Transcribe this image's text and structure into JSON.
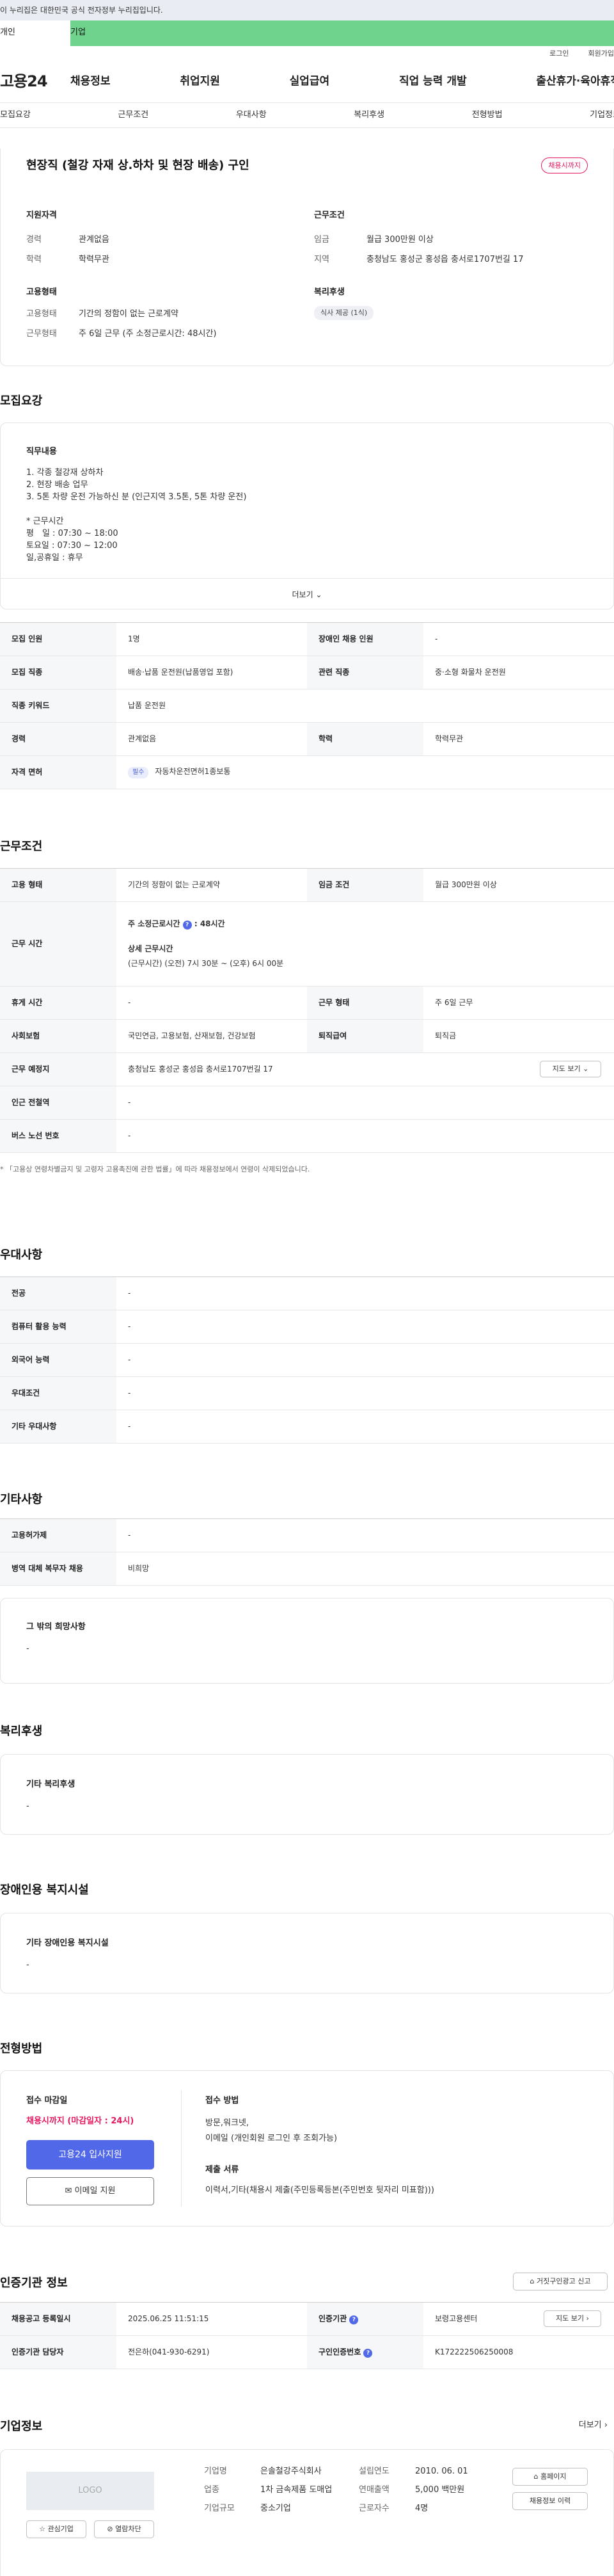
{
  "notice": "이 누리집은 대한민국 공식 전자정부 누리집입니다.",
  "tabs": [
    "개인",
    "기업"
  ],
  "util": [
    "로그인",
    "회원가입"
  ],
  "logo": "고용24",
  "gnb": [
    "채용정보",
    "취업지원",
    "실업급여",
    "직업 능력 개발",
    "출산휴가·육아휴직"
  ],
  "subnav": [
    "모집요강",
    "근무조건",
    "우대사항",
    "복리후생",
    "전형방법",
    "기업정보"
  ],
  "job": {
    "title": "현장직 (철강 자재 상.하차 및 현장 배송) 구인",
    "badge": "채용시까지",
    "req_title": "지원자격",
    "req": [
      {
        "k": "경력",
        "v": "관계없음"
      },
      {
        "k": "학력",
        "v": "학력무관"
      }
    ],
    "cond_title": "근무조건",
    "cond": [
      {
        "k": "임금",
        "v": "월급 300만원 이상"
      },
      {
        "k": "지역",
        "v": "충청남도 홍성군 홍성읍 충서로1707번길 17"
      }
    ],
    "emp_title": "고용형태",
    "emp": [
      {
        "k": "고용형태",
        "v": "기간의 정함이 없는 근로계약"
      },
      {
        "k": "근무형태",
        "v": "주 6일 근무 (주 소정근로시간: 48시간)"
      }
    ],
    "welfare_title": "복리후생",
    "welfare_pill": "식사 제공 (1식)"
  },
  "recruit": {
    "title": "모집요강",
    "duty_title": "직무내용",
    "duty": [
      "1. 각종 철강재 상하차",
      "2. 현장 배송 업무",
      "3. 5톤 차량 운전 가능하신 분 (인근지역 3.5톤, 5톤 차량 운전)",
      "",
      "* 근무시간",
      "평　일 : 07:30 ~ 18:00",
      "토요일 : 07:30 ~ 12:00",
      "일,공휴일 : 휴무"
    ],
    "more": "더보기",
    "table": [
      {
        "k1": "모집 인원",
        "v1": "1명",
        "k2": "장애인 채용 인원",
        "v2": "-"
      },
      {
        "k1": "모집 직종",
        "v1": "배송·납품 운전원(납품영업 포함)",
        "k2": "관련 직종",
        "v2": "중·소형 화물차 운전원"
      },
      {
        "k1": "직종 키워드",
        "v1": "납품 운전원"
      },
      {
        "k1": "경력",
        "v1": "관계없음",
        "k2": "학력",
        "v2": "학력무관"
      },
      {
        "k1": "자격 면허",
        "pill": "필수",
        "v1": "자동차운전면허1종보통"
      }
    ]
  },
  "work": {
    "title": "근무조건",
    "type_k": "고용 형태",
    "type_v": "기간의 정함이 없는 근로계약",
    "wage_k": "임금 조건",
    "wage_v": "월급 300만원 이상",
    "hours_k": "근무 시간",
    "hours_week_label": "주 소정근로시간",
    "hours_week_val": "48시간",
    "hours_detail_label": "상세 근무시간",
    "hours_detail_val": "(근무시간) (오전) 7시 30분 ~ (오후) 6시 00분",
    "rest_k": "휴게 시간",
    "rest_v": "-",
    "form_k": "근무 형태",
    "form_v": "주 6일 근무",
    "ins_k": "사회보험",
    "ins_v": "국민연금, 고용보험, 산재보험, 건강보험",
    "ret_k": "퇴직급여",
    "ret_v": "퇴직금",
    "loc_k": "근무 예정지",
    "loc_v": "충청남도 홍성군 홍성읍 충서로1707번길 17",
    "map_btn": "지도 보기",
    "sub_k": "인근 전철역",
    "sub_v": "-",
    "bus_k": "버스 노선 번호",
    "bus_v": "-",
    "note": "* 「고용상 연령차별금지 및 고령자 고용촉진에 관한 법률」에 따라 채용정보에서 연령이 삭제되었습니다."
  },
  "pref": {
    "title": "우대사항",
    "rows": [
      {
        "k": "전공",
        "v": "-"
      },
      {
        "k": "컴퓨터 활용 능력",
        "v": "-"
      },
      {
        "k": "외국어 능력",
        "v": "-"
      },
      {
        "k": "우대조건",
        "v": "-"
      },
      {
        "k": "기타 우대사항",
        "v": "-"
      }
    ]
  },
  "etc": {
    "title": "기타사항",
    "rows": [
      {
        "k": "고용허가제",
        "v": "-"
      },
      {
        "k": "병역 대체 복무자 채용",
        "v": "비희망"
      }
    ],
    "hope_title": "그 밖의 희망사항",
    "hope_v": "-"
  },
  "welfare": {
    "title": "복리후생",
    "box_title": "기타 복리후생",
    "box_v": "-"
  },
  "disab": {
    "title": "장애인용 복지시설",
    "box_title": "기타 장애인용 복지시설",
    "box_v": "-"
  },
  "process": {
    "title": "전형방법",
    "deadline_title": "접수 마감일",
    "deadline_v": "채용시까지 (마감일자 : 24시)",
    "apply_btn": "고용24 입사지원",
    "email_btn": "이메일 지원",
    "method_title": "접수 방법",
    "method_v": [
      "방문,워크넷,",
      "이메일 (개인회원 로그인 후 조회가능)"
    ],
    "docs_title": "제출 서류",
    "docs_v": "이력서,기타(채용시 제출(주민등록등본(주민번호 뒷자리 미표함)))"
  },
  "cert": {
    "title": "인증기관 정보",
    "report_btn": "거짓구인광고 신고",
    "rows": [
      {
        "k1": "채용공고 등록일시",
        "v1": "2025.06.25 11:51:15",
        "k2": "인증기관",
        "v2": "보령고용센터",
        "btn": "지도 보기"
      },
      {
        "k1": "인증기관 담당자",
        "v1": "전은하(041-930-6291)",
        "k2": "구인인증번호",
        "v2": "K172222506250008"
      }
    ]
  },
  "company": {
    "title": "기업정보",
    "more": "더보기",
    "logo": "LOGO",
    "fav_btn": "관심기업",
    "block_btn": "열람차단",
    "rows": [
      {
        "k": "기업명",
        "v": "은솔철강주식회사",
        "k2": "설립연도",
        "v2": "2010. 06. 01"
      },
      {
        "k": "업종",
        "v": "1차 금속제품 도매업",
        "k2": "연매출액",
        "v2": "5,000 백만원"
      },
      {
        "k": "기업규모",
        "v": "중소기업",
        "k2": "근로자수",
        "v2": "4명"
      }
    ],
    "home_btn": "홈페이지",
    "jobs_btn": "채용정보 이력"
  },
  "colors": {
    "accent": "#5168e8",
    "red": "#e4175f",
    "green": "#6fd38d"
  }
}
